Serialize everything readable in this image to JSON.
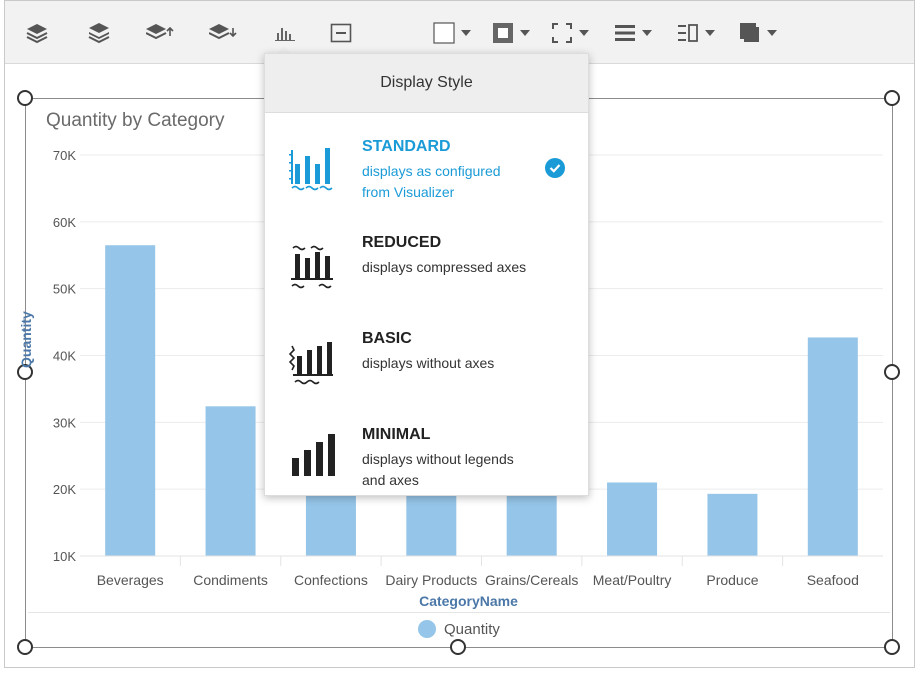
{
  "toolbar": {
    "icons": [
      "layers-icon",
      "bring-forward-icon",
      "move-up-icon",
      "move-down-icon",
      "bar-chart-icon",
      "collapse-icon",
      "fill-color-icon",
      "border-color-icon",
      "border-style-icon",
      "align-icon",
      "text-align-icon",
      "shadow-icon"
    ]
  },
  "chart_data": {
    "type": "bar",
    "title": "Quantity by Category",
    "xlabel": "CategoryName",
    "ylabel": "Quantity",
    "categories": [
      "Beverages",
      "Condiments",
      "Confections",
      "Dairy Products",
      "Grains/Cereals",
      "Meat/Poultry",
      "Produce",
      "Seafood"
    ],
    "series": [
      {
        "name": "Quantity",
        "values": [
          56500,
          32400,
          25000,
          25000,
          25000,
          21000,
          19300,
          42700
        ]
      }
    ],
    "ylim": [
      10000,
      70000
    ],
    "yticks": [
      "10K",
      "20K",
      "30K",
      "40K",
      "50K",
      "60K",
      "70K"
    ],
    "color": "#95c5e8",
    "grid": true,
    "legend": "bottom"
  },
  "popup": {
    "title": "Display Style",
    "options": [
      {
        "name": "STANDARD",
        "desc": "displays as configured from Visualizer",
        "selected": true
      },
      {
        "name": "REDUCED",
        "desc": "displays compressed axes",
        "selected": false
      },
      {
        "name": "BASIC",
        "desc": "displays without axes",
        "selected": false
      },
      {
        "name": "MINIMAL",
        "desc": "displays without legends and axes",
        "selected": false
      }
    ]
  },
  "colors": {
    "accent": "#1a9bd7",
    "bar": "#95c5e8",
    "axisLabel": "#4b78a8"
  }
}
